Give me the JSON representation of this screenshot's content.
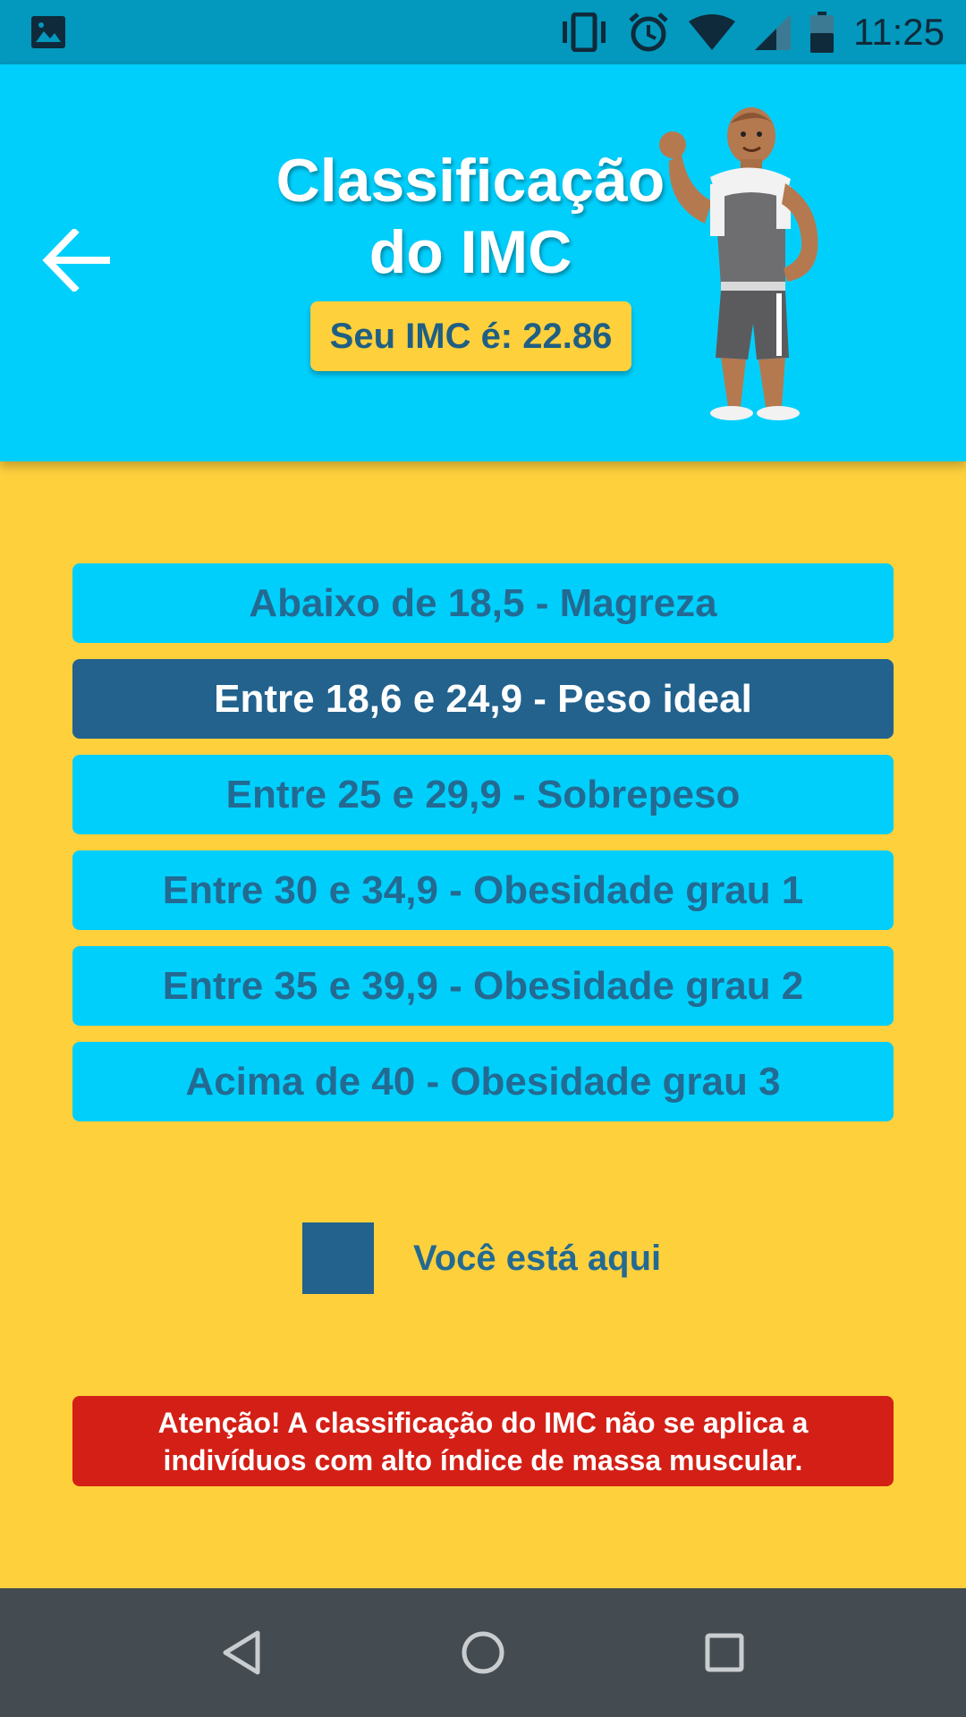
{
  "status_bar": {
    "time": "11:25",
    "icons": [
      "gallery-icon",
      "vibrate-icon",
      "alarm-icon",
      "wifi-icon",
      "signal-icon",
      "battery-icon"
    ]
  },
  "header": {
    "title_line1": "Classificação",
    "title_line2": "do IMC",
    "bmi_text": "Seu IMC é: 22.86",
    "back_icon": "arrow-left-icon",
    "mascot": "bodybuilder-mascot"
  },
  "classifications": [
    {
      "label": "Abaixo de 18,5 - Magreza",
      "active": false
    },
    {
      "label": "Entre 18,6 e 24,9 - Peso ideal",
      "active": true
    },
    {
      "label": "Entre 25 e 29,9 - Sobrepeso",
      "active": false
    },
    {
      "label": "Entre 30 e 34,9 - Obesidade grau 1",
      "active": false
    },
    {
      "label": "Entre 35 e 39,9 - Obesidade grau 2",
      "active": false
    },
    {
      "label": "Acima de 40 - Obesidade grau 3",
      "active": false
    }
  ],
  "legend": {
    "label": "Você está aqui"
  },
  "warning": {
    "line1": "Atenção! A classificação do IMC não se aplica a",
    "line2": "indivíduos com alto índice de massa muscular."
  },
  "nav_bar": {
    "icons": [
      "back-triangle-icon",
      "home-circle-icon",
      "recents-square-icon"
    ]
  },
  "colors": {
    "status_bar": "#0398BD",
    "header": "#00CFFC",
    "background": "#FED03C",
    "item_default": "#00CFFC",
    "item_active": "#22628D",
    "text_dark": "#236A92",
    "warning": "#D41F16",
    "nav_bar": "#444C51"
  }
}
